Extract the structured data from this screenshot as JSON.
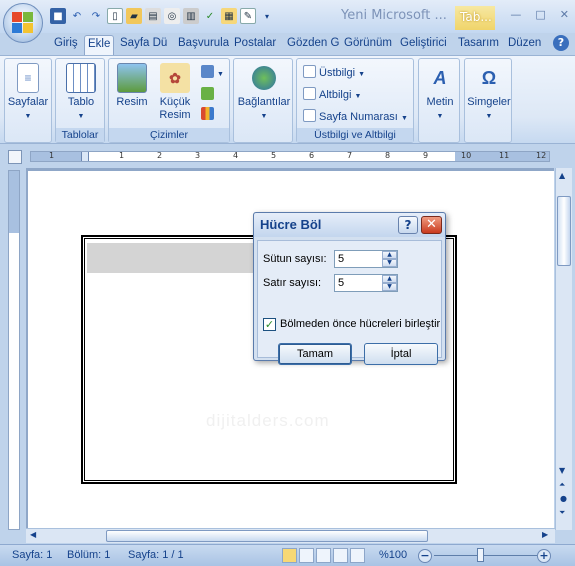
{
  "window": {
    "title": "Yeni Microsoft ...",
    "context_tab": "Tab...",
    "min": "—",
    "restore": "□",
    "close": "✕"
  },
  "tabs": [
    "Giriş",
    "Ekle",
    "Sayfa Dü",
    "Başvurula",
    "Postalar",
    "Gözden G",
    "Görünüm",
    "Geliştirici",
    "Tasarım",
    "Düzen"
  ],
  "active_tab": "Ekle",
  "help": "?",
  "ribbon": {
    "sayfalar": "Sayfalar",
    "tablo": "Tablo",
    "resim": "Resim",
    "kucuk_resim_1": "Küçük",
    "kucuk_resim_2": "Resim",
    "baglantilar": "Bağlantılar",
    "ustbilgi": "Üstbilgi",
    "altbilgi": "Altbilgi",
    "sayfa_numarasi": "Sayfa Numarası",
    "metin": "Metin",
    "simgeler": "Simgeler",
    "groups": {
      "tablolar": "Tablolar",
      "cizimler": "Çizimler",
      "ustbilgi_altbilgi": "Üstbilgi ve Altbilgi"
    }
  },
  "ruler_numbers": [
    "1",
    "1",
    "1",
    "2",
    "3",
    "4",
    "5",
    "6",
    "7",
    "8",
    "9",
    "10",
    "11",
    "12"
  ],
  "dialog": {
    "title": "Hücre Böl",
    "help": "?",
    "close": "✕",
    "sutun_label": "Sütun sayısı:",
    "sutun_value": "5",
    "satir_label": "Satır sayısı:",
    "satir_value": "5",
    "merge_label": "Bölmeden önce hücreleri birleştir",
    "merge_checked": true,
    "ok": "Tamam",
    "cancel": "İptal"
  },
  "watermark": "dijitalders.com",
  "status": {
    "sayfa": "Sayfa: 1",
    "bolum": "Bölüm: 1",
    "sayfa_of": "Sayfa: 1 / 1",
    "zoom": "%100",
    "zoom_minus": "−",
    "zoom_plus": "+",
    "zoom_level_fraction": 0.45
  }
}
